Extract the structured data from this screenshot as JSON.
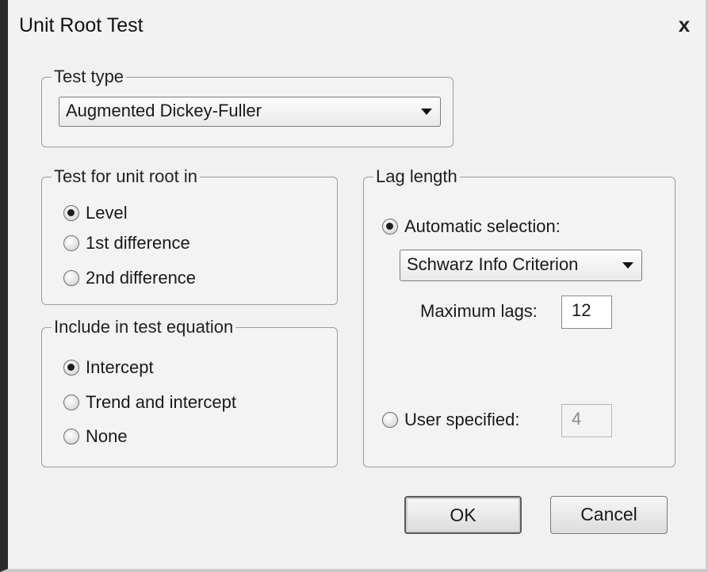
{
  "window": {
    "title": "Unit Root Test",
    "close_label": "x"
  },
  "test_type": {
    "legend": "Test type",
    "selected": "Augmented Dickey-Fuller"
  },
  "unit_root_in": {
    "legend": "Test for unit root in",
    "options": [
      {
        "label": "Level",
        "checked": true
      },
      {
        "label": "1st difference",
        "checked": false
      },
      {
        "label": "2nd difference",
        "checked": false
      }
    ]
  },
  "test_equation": {
    "legend": "Include in test equation",
    "options": [
      {
        "label": "Intercept",
        "checked": true
      },
      {
        "label": "Trend and intercept",
        "checked": false
      },
      {
        "label": "None",
        "checked": false
      }
    ]
  },
  "lag_length": {
    "legend": "Lag length",
    "automatic_label": "Automatic selection:",
    "automatic_checked": true,
    "criterion_selected": "Schwarz Info Criterion",
    "max_lags_label": "Maximum lags:",
    "max_lags_value": "12",
    "user_specified_label": "User specified:",
    "user_specified_checked": false,
    "user_specified_value": "4"
  },
  "buttons": {
    "ok": "OK",
    "cancel": "Cancel"
  }
}
